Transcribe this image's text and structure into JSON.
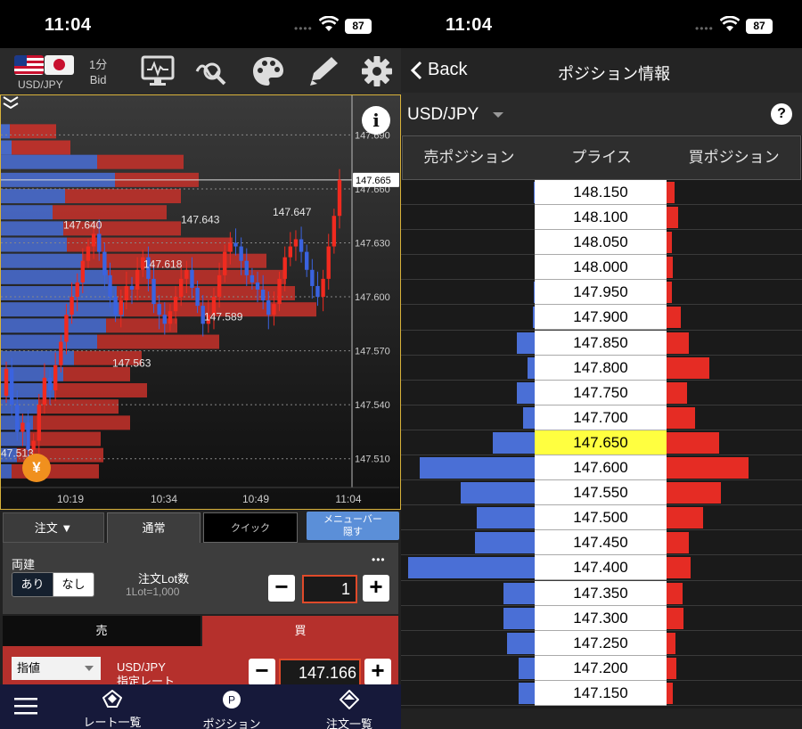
{
  "left": {
    "status": {
      "time": "11:04",
      "battery": "87"
    },
    "toolbar": {
      "pair": "USD/JPY",
      "timeframe": "1分",
      "price_type": "Bid"
    },
    "chart_data": {
      "type": "candlestick",
      "x_ticks": [
        "10:19",
        "10:34",
        "10:49",
        "11:04"
      ],
      "y_ticks": [
        147.69,
        147.66,
        147.63,
        147.6,
        147.57,
        147.54,
        147.51
      ],
      "y_tick_labels": [
        "147.690",
        "147.660",
        "147.630",
        "147.600",
        "147.570",
        "147.540",
        "147.510"
      ],
      "current_price": "147.665",
      "annotations": [
        {
          "label": "147.640",
          "price": 147.64
        },
        {
          "label": "147.643",
          "price": 147.643
        },
        {
          "label": "147.647",
          "price": 147.647
        },
        {
          "label": "147.618",
          "price": 147.618
        },
        {
          "label": "147.589",
          "price": 147.589
        },
        {
          "label": "147.563",
          "price": 147.563
        },
        {
          "label": "47.513",
          "price": 147.513
        }
      ]
    },
    "order": {
      "tab_order": "注文 ▼",
      "tab_normal": "通常",
      "tab_quick": "クイック",
      "tab_menu": "メニューバー\n隠す",
      "ryodate": "両建",
      "ari": "あり",
      "nashi": "なし",
      "lot_title": "注文Lot数",
      "lot_sub": "1Lot=1,000",
      "more": "•••",
      "qty": "1",
      "sell": "売",
      "buy": "買",
      "limit_type": "指値",
      "limit_pair": "USD/JPY",
      "limit_sub": "指定レート",
      "limit_price": "147.166"
    },
    "tabbar": {
      "rates": "レート一覧",
      "position": "ポジション",
      "orders": "注文一覧"
    }
  },
  "right": {
    "status": {
      "time": "11:04",
      "battery": "87"
    },
    "nav": {
      "back": "Back",
      "title": "ポジション情報"
    },
    "pair": "USD/JPY",
    "headers": {
      "sell": "売ポジション",
      "price": "プライス",
      "buy": "買ポジション"
    },
    "current_price": "147.650",
    "orderbook": [
      {
        "price": "148.150",
        "sell": 1,
        "buy": 9
      },
      {
        "price": "148.100",
        "sell": 0,
        "buy": 13
      },
      {
        "price": "148.050",
        "sell": 0,
        "buy": 6
      },
      {
        "price": "148.000",
        "sell": 0,
        "buy": 7
      },
      {
        "price": "147.950",
        "sell": 1,
        "buy": 6
      },
      {
        "price": "147.900",
        "sell": 2,
        "buy": 16
      },
      {
        "price": "147.850",
        "sell": 20,
        "buy": 25
      },
      {
        "price": "147.800",
        "sell": 8,
        "buy": 48
      },
      {
        "price": "147.750",
        "sell": 20,
        "buy": 23
      },
      {
        "price": "147.700",
        "sell": 13,
        "buy": 32
      },
      {
        "price": "147.650",
        "sell": 47,
        "buy": 59
      },
      {
        "price": "147.600",
        "sell": 129,
        "buy": 92
      },
      {
        "price": "147.550",
        "sell": 83,
        "buy": 61
      },
      {
        "price": "147.500",
        "sell": 65,
        "buy": 41
      },
      {
        "price": "147.450",
        "sell": 67,
        "buy": 25
      },
      {
        "price": "147.400",
        "sell": 142,
        "buy": 27
      },
      {
        "price": "147.350",
        "sell": 35,
        "buy": 18
      },
      {
        "price": "147.300",
        "sell": 35,
        "buy": 19
      },
      {
        "price": "147.250",
        "sell": 31,
        "buy": 10
      },
      {
        "price": "147.200",
        "sell": 18,
        "buy": 11
      },
      {
        "price": "147.150",
        "sell": 18,
        "buy": 7
      }
    ]
  }
}
